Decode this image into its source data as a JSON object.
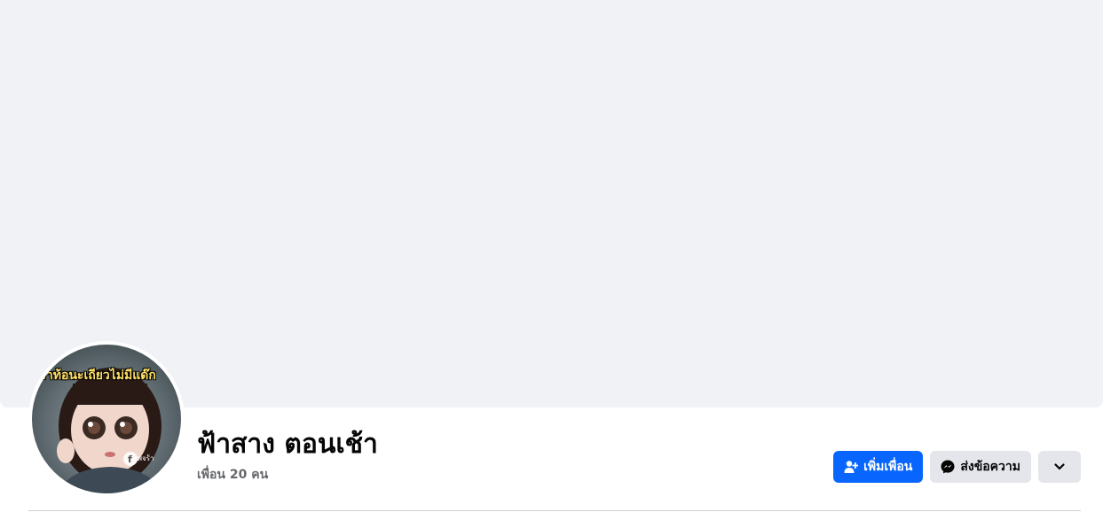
{
  "profile": {
    "name": "ฟ้าสาง ตอนเช้า",
    "friends_count": "เพื่อน 20 คน",
    "avatar_caption": "ว่าท้อนะเถียวไม่มีแด๊ก",
    "avatar_watermark": "เพจร้า"
  },
  "actions": {
    "add_friend": "เพิ่มเพื่อน",
    "message": "ส่งข้อความ"
  },
  "icons": {
    "add_friend": "add-person-icon",
    "message": "messenger-icon",
    "more": "chevron-down-icon"
  },
  "colors": {
    "primary": "#0866ff",
    "secondary": "#e4e6eb",
    "cover": "#f0f2f5"
  }
}
